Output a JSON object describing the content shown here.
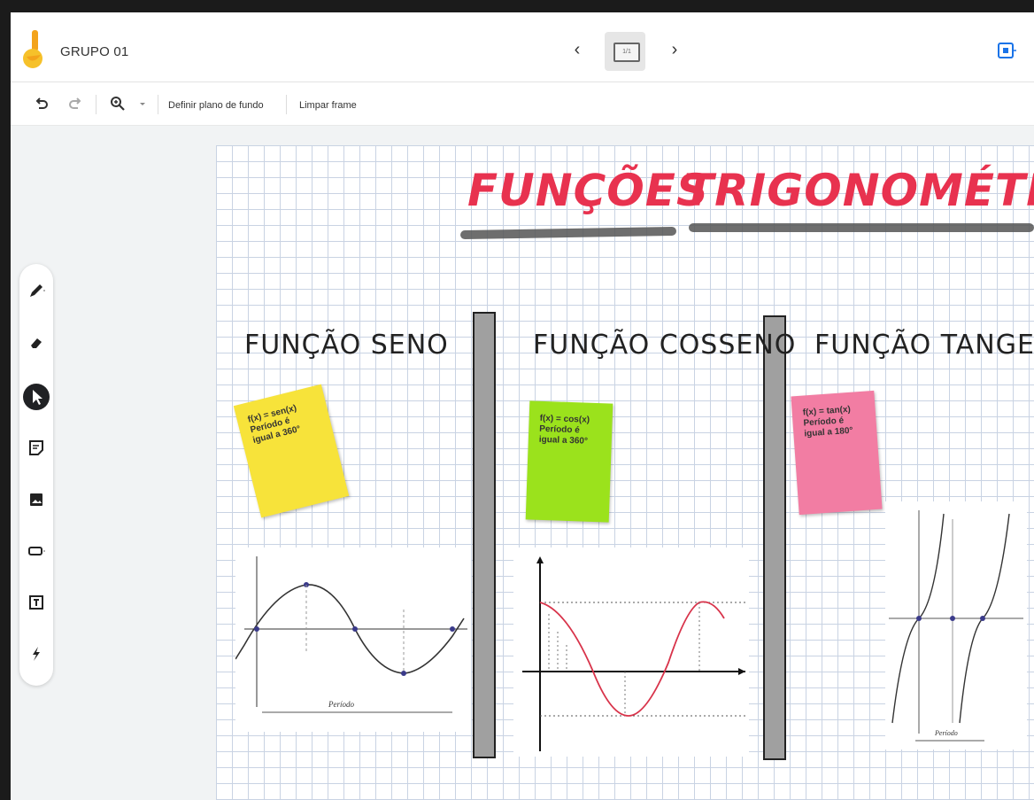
{
  "header": {
    "title": "GRUPO 01",
    "prev_label": "‹",
    "next_label": "›",
    "frame_indicator": "1/1"
  },
  "toolbar": {
    "set_background_label": "Definir plano de fundo",
    "clear_frame_label": "Limpar frame"
  },
  "board": {
    "title_word1": "FUNÇÕES",
    "title_word2": "TRIGONOMÉTRICAS",
    "sections": [
      {
        "heading": "FUNÇÃO SENO",
        "note_line1": "f(x) = sen(x)",
        "note_line2": "Período é",
        "note_line3": "igual a 360°",
        "note_color": "#f7e33a",
        "graph_bottom_label": "Período"
      },
      {
        "heading": "FUNÇÃO COSSENO",
        "note_line1": "f(x) = cos(x)",
        "note_line2": "Período é",
        "note_line3": "igual a 360°",
        "note_color": "#9be21c"
      },
      {
        "heading": "FUNÇÃO TANGENTE",
        "note_line1": "f(x) = tan(x)",
        "note_line2": "Período é",
        "note_line3": "igual a 180°",
        "note_color": "#f27da3",
        "graph_bottom_label": "Período"
      }
    ]
  },
  "colors": {
    "title_red": "#e8324f",
    "grid_line": "#c9d3e3",
    "divider": "#a0a0a0"
  }
}
